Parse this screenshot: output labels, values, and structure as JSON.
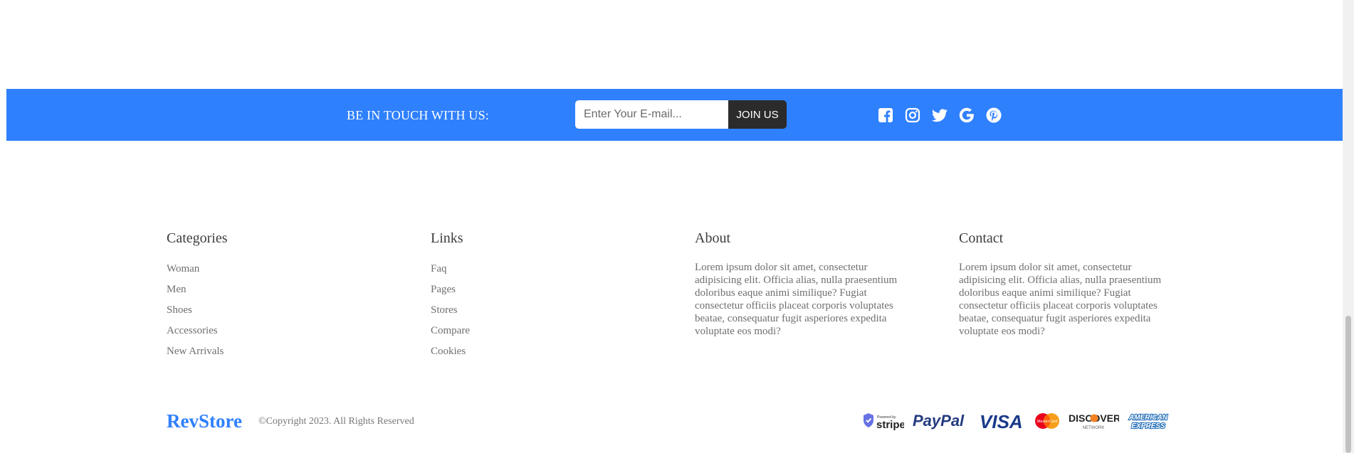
{
  "newsletter": {
    "label": "BE IN TOUCH WITH US:",
    "email_placeholder": "Enter Your E-mail...",
    "join_label": "JOIN US",
    "social_icons": [
      "facebook-icon",
      "instagram-icon",
      "twitter-icon",
      "google-icon",
      "pinterest-icon"
    ]
  },
  "footer": {
    "categories": {
      "title": "Categories",
      "items": [
        "Woman",
        "Men",
        "Shoes",
        "Accessories",
        "New Arrivals"
      ]
    },
    "links": {
      "title": "Links",
      "items": [
        "Faq",
        "Pages",
        "Stores",
        "Compare",
        "Cookies"
      ]
    },
    "about": {
      "title": "About",
      "text": "Lorem ipsum dolor sit amet, consectetur adipisicing elit. Officia alias, nulla praesentium doloribus eaque animi similique? Fugiat consectetur officiis placeat corporis voluptates beatae, consequatur fugit asperiores expedita voluptate eos modi?"
    },
    "contact": {
      "title": "Contact",
      "text": "Lorem ipsum dolor sit amet, consectetur adipisicing elit. Officia alias, nulla praesentium doloribus eaque animi similique? Fugiat consectetur officiis placeat corporis voluptates beatae, consequatur fugit asperiores expedita voluptate eos modi?"
    }
  },
  "bottom": {
    "brand": "RevStore",
    "copyright": "©Copyright 2023. All Rights Reserved",
    "payments": {
      "stripe_small": "Powered by",
      "stripe": "stripe",
      "paypal": "PayPal",
      "visa": "VISA",
      "mastercard": "MasterCard",
      "discover": "DISCOVER",
      "discover_sub": "NETWORK",
      "amex_line1": "AMERICAN",
      "amex_line2": "EXPRESS"
    }
  },
  "colors": {
    "accent": "#2f80fd",
    "join_button": "#2b2b2b"
  }
}
